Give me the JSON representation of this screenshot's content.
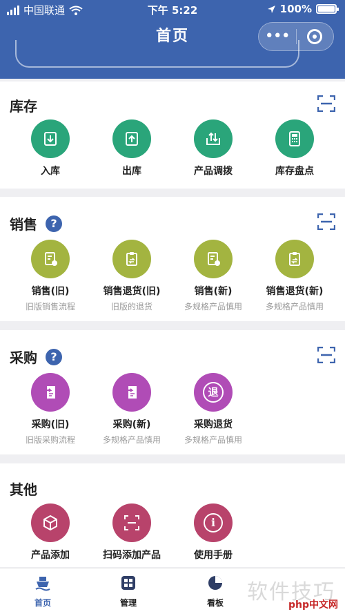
{
  "status": {
    "carrier": "中国联通",
    "time": "下午 5:22",
    "battery": "100%",
    "battery_level": 1.0
  },
  "nav": {
    "title": "首页",
    "more_label": "•••",
    "close_icon": "record-icon"
  },
  "sections": {
    "inventory": {
      "title": "库存",
      "items": [
        {
          "label": "入库",
          "icon": "inbound-icon"
        },
        {
          "label": "出库",
          "icon": "outbound-icon"
        },
        {
          "label": "产品调拨",
          "icon": "transfer-icon"
        },
        {
          "label": "库存盘点",
          "icon": "calculator-icon"
        }
      ]
    },
    "sales": {
      "title": "销售",
      "help": "?",
      "items": [
        {
          "label": "销售(旧)",
          "sub": "旧版销售流程"
        },
        {
          "label": "销售退货(旧)",
          "sub": "旧版的退货"
        },
        {
          "label": "销售(新)",
          "sub": "多规格产品慎用"
        },
        {
          "label": "销售退货(新)",
          "sub": "多规格产品慎用"
        }
      ]
    },
    "purchase": {
      "title": "采购",
      "help": "?",
      "items": [
        {
          "label": "采购(旧)",
          "sub": "旧版采购流程"
        },
        {
          "label": "采购(新)",
          "sub": "多规格产品慎用"
        },
        {
          "label": "采购退货",
          "sub": "多规格产品慎用",
          "glyph": "退"
        }
      ]
    },
    "other": {
      "title": "其他",
      "items": [
        {
          "label": "产品添加"
        },
        {
          "label": "扫码添加产品"
        },
        {
          "label": "使用手册",
          "glyph": "i"
        }
      ]
    }
  },
  "tabbar": [
    {
      "label": "首页",
      "active": true
    },
    {
      "label": "管理"
    },
    {
      "label": "看板"
    }
  ],
  "watermark": "软件技巧",
  "watermark2": "php中文网",
  "colors": {
    "brand": "#3d64ae",
    "inventory": "#2aa57a",
    "sales": "#a3b440",
    "purchase": "#b04cb6",
    "other": "#b8436b"
  }
}
